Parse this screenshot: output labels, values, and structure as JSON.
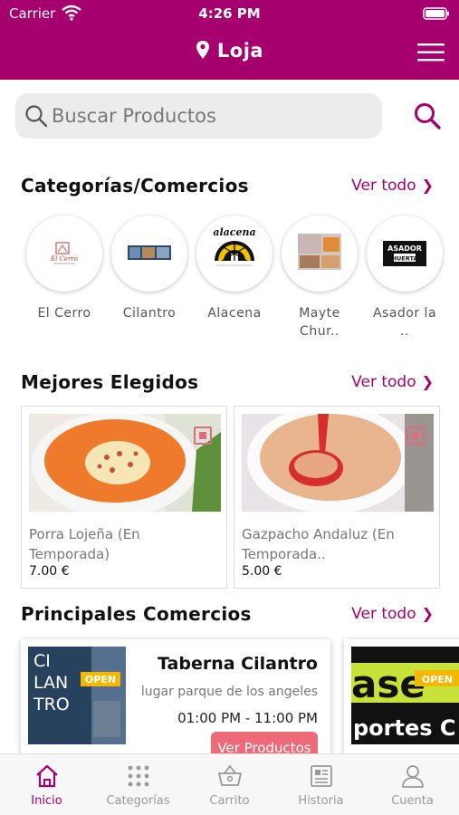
{
  "status": {
    "carrier": "Carrier",
    "time": "4:26 PM"
  },
  "header": {
    "location": "Loja"
  },
  "search": {
    "placeholder": "Buscar Productos"
  },
  "categories": {
    "title": "Categorías/Comercios",
    "see_all": "Ver todo",
    "items": [
      {
        "label": "El Cerro"
      },
      {
        "label": "Cilantro"
      },
      {
        "label": "Alacena"
      },
      {
        "label": "Mayte\nChur.."
      },
      {
        "label": "Asador la\n.."
      }
    ]
  },
  "best": {
    "title": "Mejores Elegidos",
    "see_all": "Ver todo",
    "products": [
      {
        "name": "Porra Lojeña (En Temporada)",
        "price": "7.00 €"
      },
      {
        "name": "Gazpacho Andaluz (En Temporada..",
        "price": "5.00 €"
      }
    ]
  },
  "stores": {
    "title": "Principales Comercios",
    "see_all": "Ver todo",
    "items": [
      {
        "name": "Taberna Cilantro",
        "address": "lugar parque de los angeles",
        "hours": "01:00 PM - 11:00 PM",
        "button": "Ver Productos",
        "img_text": "CILANTRO",
        "img_badge": "OPEN"
      }
    ],
    "partial_badge": "OPEN"
  },
  "tabs": [
    {
      "label": "Inicio",
      "active": true
    },
    {
      "label": "Categorías"
    },
    {
      "label": "Carrito"
    },
    {
      "label": "Historia"
    },
    {
      "label": "Cuenta"
    }
  ],
  "colors": {
    "brand": "#a6006f",
    "accent_button": "#ef6a78"
  }
}
